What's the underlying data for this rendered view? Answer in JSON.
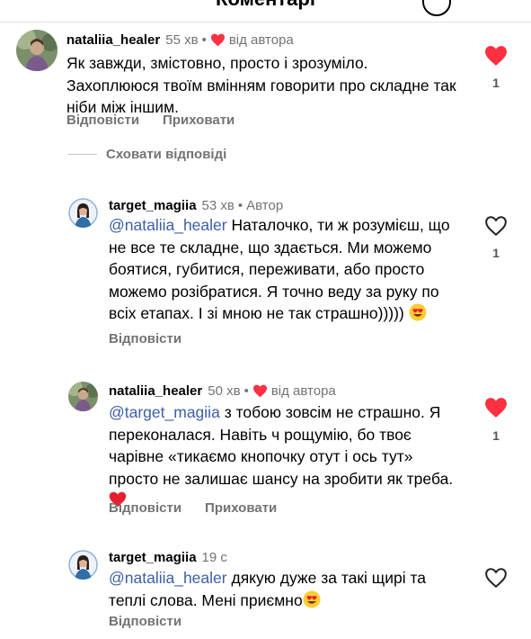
{
  "header": {
    "title": "Коментарі"
  },
  "comments": [
    {
      "username": "nataliia_healer",
      "time": "55 хв",
      "author_like_label": "від автора",
      "text": "Як завжди, змістовно, просто і зрозуміло. Захоплююся твоїм вмінням говорити про складне так ніби між іншим.",
      "like_count": "1",
      "liked": true,
      "reply_label": "Відповісти",
      "hide_label": "Приховати"
    },
    {
      "username": "target_magiia",
      "time": "53 хв",
      "author_badge": "Автор",
      "mention": "@nataliia_healer",
      "text": "Наталочко, ти ж розумієш, що не все те складне, що здається. Ми можемо боятися, губитися, переживати, або просто можемо розібратися. Я точно веду за руку по всіх етапах. І зі мною не так страшно)))))",
      "like_count": "1",
      "liked": false,
      "reply_label": "Відповісти"
    },
    {
      "username": "nataliia_healer",
      "time": "50 хв",
      "author_like_label": "від автора",
      "mention": "@target_magiia",
      "text": "з тобою зовсім не страшно. Я переконалася. Навіть ч рощумію, бо твоє чарівне «тикаємо кнопочку отут і ось тут» просто не залишає шансу на зробити як треба.",
      "like_count": "1",
      "liked": true,
      "reply_label": "Відповісти",
      "hide_label": "Приховати"
    },
    {
      "username": "target_magiia",
      "time": "19 с",
      "mention": "@nataliia_healer",
      "text": "дякую дуже за такі щирі та теплі слова. Мені приємно",
      "liked": false,
      "reply_label": "Відповісти"
    }
  ],
  "hide_replies_label": "Сховати відповіді",
  "colors": {
    "heart": "#ff3040",
    "mention": "#3b5fa8",
    "secondary_text": "#737373"
  }
}
